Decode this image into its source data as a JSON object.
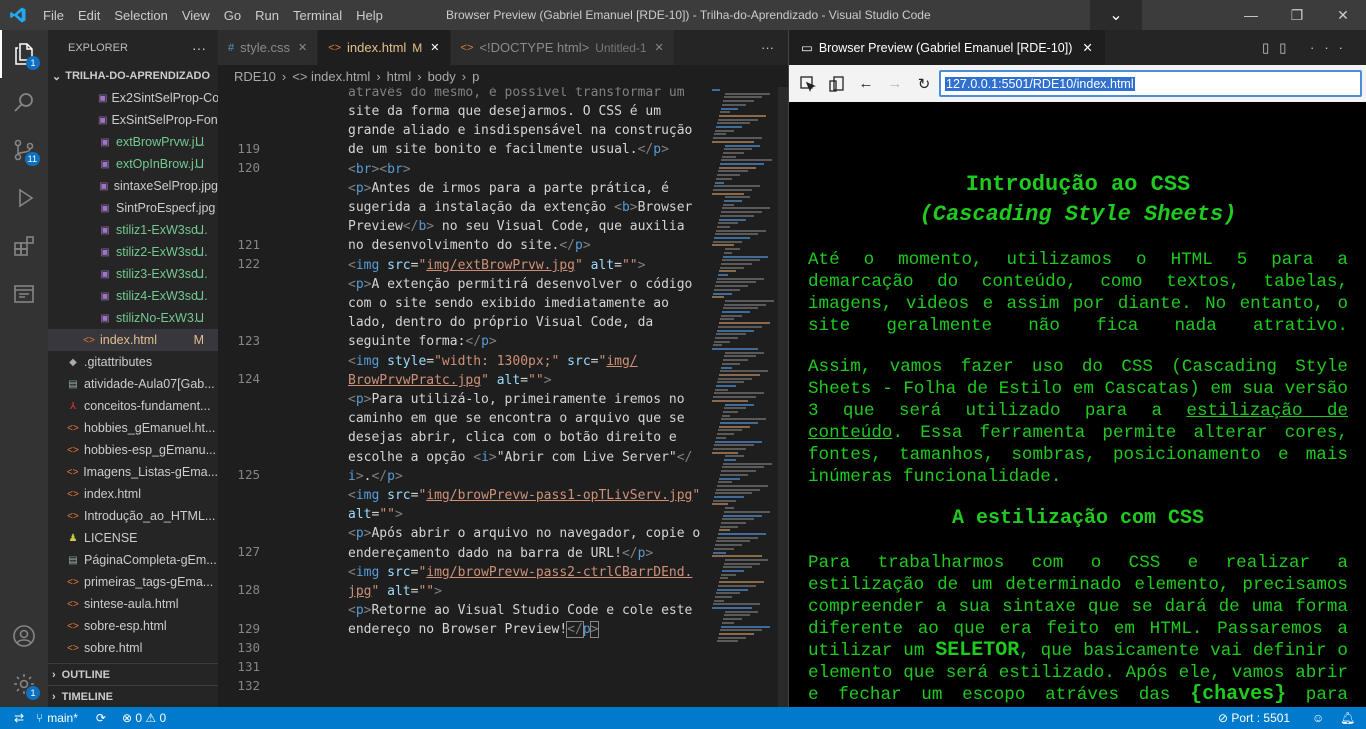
{
  "titlebar": {
    "menu": [
      "File",
      "Edit",
      "Selection",
      "View",
      "Go",
      "Run",
      "Terminal",
      "Help"
    ],
    "title": "Browser Preview (Gabriel Emanuel [RDE-10]) - Trilha-do-Aprendizado - Visual Studio Code"
  },
  "activity": {
    "explorer_badge": "1",
    "scm_badge": "11",
    "settings_badge": "1"
  },
  "sidebar": {
    "header": "EXPLORER",
    "more": "···",
    "root": "TRILHA-DO-APRENDIZADO",
    "files": [
      {
        "name": "Ex2SintSelProp-Col...",
        "status": "",
        "indent": 2,
        "icon": "img",
        "color": "#ccc"
      },
      {
        "name": "ExSintSelProp-Font...",
        "status": "",
        "indent": 2,
        "icon": "img",
        "color": "#ccc"
      },
      {
        "name": "extBrowPrvw.j...",
        "status": "U",
        "indent": 2,
        "icon": "img",
        "color": "#73c991"
      },
      {
        "name": "extOpInBrow.j...",
        "status": "U",
        "indent": 2,
        "icon": "img",
        "color": "#73c991"
      },
      {
        "name": "sintaxeSelProp.jpg",
        "status": "",
        "indent": 2,
        "icon": "img",
        "color": "#ccc"
      },
      {
        "name": "SintProEspecf.jpg",
        "status": "",
        "indent": 2,
        "icon": "img",
        "color": "#ccc"
      },
      {
        "name": "stiliz1-ExW3sc...",
        "status": "U",
        "indent": 2,
        "icon": "img",
        "color": "#73c991"
      },
      {
        "name": "stiliz2-ExW3sc...",
        "status": "U",
        "indent": 2,
        "icon": "img",
        "color": "#73c991"
      },
      {
        "name": "stiliz3-ExW3sc...",
        "status": "U",
        "indent": 2,
        "icon": "img",
        "color": "#73c991"
      },
      {
        "name": "stiliz4-ExW3sc...",
        "status": "U",
        "indent": 2,
        "icon": "img",
        "color": "#73c991"
      },
      {
        "name": "stilizNo-ExW3...",
        "status": "U",
        "indent": 2,
        "icon": "img",
        "color": "#73c991"
      },
      {
        "name": "index.html",
        "status": "M",
        "indent": 1,
        "icon": "html",
        "color": "#e2c08d"
      },
      {
        "name": ".gitattributes",
        "status": "",
        "indent": 0,
        "icon": "git",
        "color": "#ccc"
      },
      {
        "name": "atividade-Aula07[Gab...",
        "status": "",
        "indent": 0,
        "icon": "doc",
        "color": "#ccc"
      },
      {
        "name": "conceitos-fundament...",
        "status": "",
        "indent": 0,
        "icon": "pdf",
        "color": "#ccc"
      },
      {
        "name": "hobbies_gEmanuel.ht...",
        "status": "",
        "indent": 0,
        "icon": "html",
        "color": "#ccc"
      },
      {
        "name": "hobbies-esp_gEmanu...",
        "status": "",
        "indent": 0,
        "icon": "html",
        "color": "#ccc"
      },
      {
        "name": "Imagens_Listas-gEma...",
        "status": "",
        "indent": 0,
        "icon": "html",
        "color": "#ccc"
      },
      {
        "name": "index.html",
        "status": "",
        "indent": 0,
        "icon": "html",
        "color": "#ccc"
      },
      {
        "name": "Introdução_ao_HTML...",
        "status": "",
        "indent": 0,
        "icon": "html",
        "color": "#ccc"
      },
      {
        "name": "LICENSE",
        "status": "",
        "indent": 0,
        "icon": "lic",
        "color": "#ccc"
      },
      {
        "name": "PáginaCompleta-gEm...",
        "status": "",
        "indent": 0,
        "icon": "doc",
        "color": "#ccc"
      },
      {
        "name": "primeiras_tags-gEma...",
        "status": "",
        "indent": 0,
        "icon": "html",
        "color": "#ccc"
      },
      {
        "name": "sintese-aula.html",
        "status": "",
        "indent": 0,
        "icon": "html",
        "color": "#ccc"
      },
      {
        "name": "sobre-esp.html",
        "status": "",
        "indent": 0,
        "icon": "html",
        "color": "#ccc"
      },
      {
        "name": "sobre.html",
        "status": "",
        "indent": 0,
        "icon": "html",
        "color": "#ccc"
      }
    ],
    "outline": "OUTLINE",
    "timeline": "TIMELINE"
  },
  "editor": {
    "tabs": [
      {
        "icon": "#",
        "label": "style.css",
        "badge": "",
        "active": false
      },
      {
        "icon": "<>",
        "label": "index.html",
        "badge": "M",
        "active": true
      },
      {
        "icon": "<>",
        "label": "<!DOCTYPE html>",
        "badge": "Untitled-1",
        "active": false
      }
    ],
    "tab_more": "···",
    "breadcrumbs": [
      "RDE10",
      "›",
      "<> index.html",
      "›",
      "html",
      "›",
      "body",
      "›",
      "p"
    ],
    "line_numbers": [
      {
        "n": "119",
        "row": 3
      },
      {
        "n": "120",
        "row": 4
      },
      {
        "n": "121",
        "row": 8
      },
      {
        "n": "122",
        "row": 9
      },
      {
        "n": "123",
        "row": 13
      },
      {
        "n": "124",
        "row": 15
      },
      {
        "n": "125",
        "row": 20
      },
      {
        "n": "127",
        "row": 24
      },
      {
        "n": "128",
        "row": 26
      },
      {
        "n": "129",
        "row": 28
      },
      {
        "n": "130",
        "row": 29
      },
      {
        "n": "131",
        "row": 30
      },
      {
        "n": "132",
        "row": 31
      }
    ]
  },
  "preview": {
    "tab_title": "Browser Preview (Gabriel Emanuel [RDE-10])",
    "url": "127.0.0.1:5501/RDE10/index.html",
    "h1_line1": "Introdução ao CSS",
    "h1_line2": "(Cascading Style Sheets)",
    "p1": "Até o momento, utilizamos o HTML 5 para a demarcação do conteúdo, como textos, tabelas, imagens, videos e assim por diante. No entanto, o site geralmente não fica nada atrativo.",
    "p2a": "Assim, vamos fazer uso do CSS (Cascading Style Sheets - Folha de Estilo em Cascatas) em sua versão 3 que será utilizado para a ",
    "p2link": "estilização de conteúdo",
    "p2b": ". Essa ferramenta permite alterar cores, fontes, tamanhos, sombras, posicionamento e mais inúmeras funcionalidade.",
    "h2": "A estilização com CSS",
    "p3a": "Para trabalharmos com o CSS e realizar a estilização de um determinado elemento, precisamos compreender a sua sintaxe que se dará de uma forma diferente ao que era feito em HTML. Passaremos a utilizar um ",
    "p3b1": "SELETOR",
    "p3b": ", que basicamente vai definir o elemento que será estilizado. Após ele, vamos abrir e fechar um escopo atráves das ",
    "p3b2": "{chaves}",
    "p3c": " para começar, na"
  },
  "statusbar": {
    "branch": "main*",
    "sync": "⟳",
    "errors": "⊗ 0 ⚠ 0",
    "port": "⊘ Port : 5501"
  }
}
